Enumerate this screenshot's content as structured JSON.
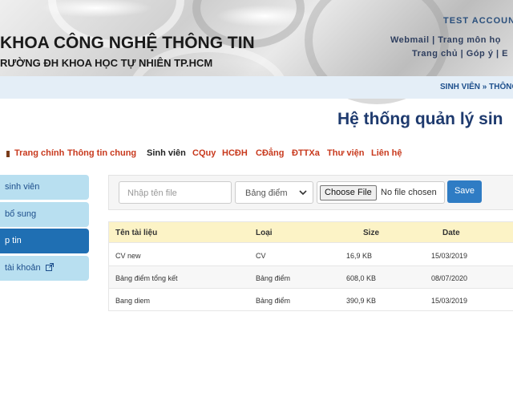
{
  "header": {
    "faculty": "KHOA CÔNG NGHỆ THÔNG TIN",
    "university": "RƯỜNG ĐH KHOA HỌC TỰ NHIÊN TP.HCM",
    "account": "TEST ACCOUN",
    "links_row1": [
      "Webmail",
      "Trang môn họ"
    ],
    "links_row2": [
      "Trang chủ",
      "Góp ý",
      "E"
    ]
  },
  "breadcrumb": {
    "item1": "SINH VIÊN",
    "separator": "»",
    "item2": "THÔNG"
  },
  "system_title": "Hệ thống quản lý sin",
  "menu": {
    "items": [
      {
        "label": "Trang chính",
        "color": "#c8391d"
      },
      {
        "label": "Thông tin chung",
        "color": "#c8391d"
      },
      {
        "label": "Sinh viên",
        "color": "#222222"
      },
      {
        "label": "CQuy",
        "color": "#c8391d"
      },
      {
        "label": "HCĐH",
        "color": "#c8391d"
      },
      {
        "label": "CĐẳng",
        "color": "#c8391d"
      },
      {
        "label": "ĐTTXa",
        "color": "#c8391d"
      },
      {
        "label": "Thư viện",
        "color": "#c8391d"
      },
      {
        "label": "Liên hệ",
        "color": "#c8391d"
      }
    ]
  },
  "sidebar": {
    "items": [
      {
        "label": "sinh viên",
        "active": false
      },
      {
        "label": "bổ sung",
        "active": false
      },
      {
        "label": "p tin",
        "active": true
      },
      {
        "label": "tài khoản",
        "active": false,
        "icon": "external-link-icon"
      }
    ]
  },
  "upload": {
    "filename_placeholder": "Nhập tên file",
    "type_selected": "Bảng điểm",
    "choose_file_label": "Choose File",
    "no_file_text": "No file chosen",
    "save_label": "Save"
  },
  "files_table": {
    "columns": [
      "Tên tài liệu",
      "Loại",
      "Size",
      "Date"
    ],
    "rows": [
      {
        "name": "CV new",
        "type": "CV",
        "size": "16,9 KB",
        "date": "15/03/2019"
      },
      {
        "name": "Bảng điểm tổng kết",
        "type": "Bảng điểm",
        "size": "608,0 KB",
        "date": "08/07/2020"
      },
      {
        "name": "Bang diem",
        "type": "Bảng điểm",
        "size": "390,9 KB",
        "date": "15/03/2019"
      }
    ]
  },
  "colors": {
    "title_blue": "#1e3a6e",
    "menu_red": "#c8391d",
    "sidebar_bg": "#b8dff0",
    "sidebar_active": "#1f6fb3",
    "save_button": "#2f7cc4",
    "table_header_bg": "#fcf3c6",
    "breadcrumb_bg": "#e4eef7"
  }
}
